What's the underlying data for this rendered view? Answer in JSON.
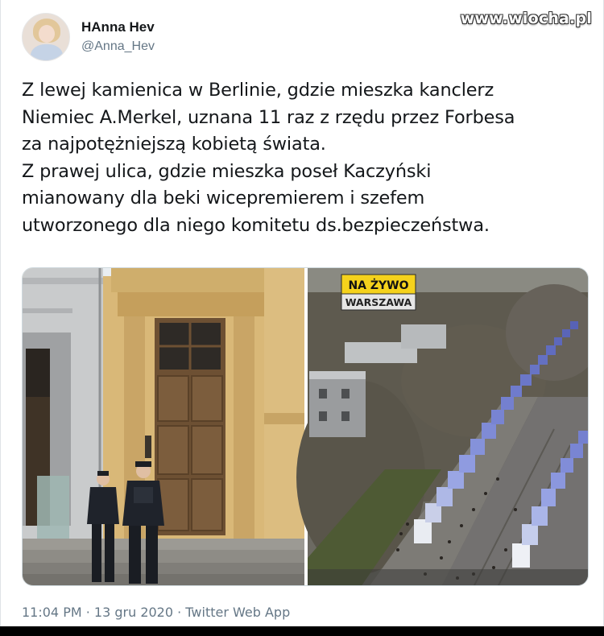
{
  "tweet": {
    "display_name": "HAnna Hev",
    "handle": "@Anna_Hev",
    "lines": [
      "Z lewej kamienica w Berlinie, gdzie mieszka kanclerz",
      "Niemiec A.Merkel, uznana 11 raz z rzędu przez Forbesa",
      "za najpotężniejszą kobietą świata.",
      "Z prawej ulica, gdzie mieszka poseł Kaczyński",
      "mianowany dla beki wicepremierem i szefem",
      "utworzonego dla niego komitetu ds.bezpieczeństwa."
    ],
    "meta": "11:04 PM · 13 gru 2020 · Twitter Web App"
  },
  "watermark": "www.wiocha.pl",
  "media": {
    "overlay_top": "NA ŻYWO",
    "overlay_bottom": "WARSZAWA"
  },
  "icons": {
    "avatar": "profile-photo"
  }
}
